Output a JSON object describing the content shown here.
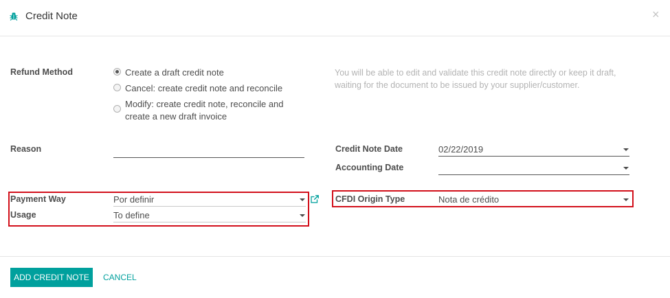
{
  "dialog": {
    "title": "Credit Note",
    "close_label": "×"
  },
  "refund_method": {
    "label": "Refund Method",
    "options": [
      {
        "line1": "Create a draft credit note",
        "line2": "",
        "selected": true
      },
      {
        "line1": "Cancel: create credit note and reconcile",
        "line2": "",
        "selected": false
      },
      {
        "line1": "Modify: create credit note, reconcile and",
        "line2": "create a new draft invoice",
        "selected": false
      }
    ],
    "help_text": "You will be able to edit and validate this credit note directly or keep it draft, waiting for the document to be issued by your supplier/customer."
  },
  "reason": {
    "label": "Reason",
    "value": ""
  },
  "credit_note_date": {
    "label": "Credit Note Date",
    "value": "02/22/2019"
  },
  "accounting_date": {
    "label": "Accounting Date",
    "value": ""
  },
  "payment_way": {
    "label": "Payment Way",
    "value": "Por definir"
  },
  "usage": {
    "label": "Usage",
    "value": "To define"
  },
  "cfdi_origin_type": {
    "label": "CFDI Origin Type",
    "value": "Nota de crédito"
  },
  "footer": {
    "add_button": "ADD CREDIT NOTE",
    "cancel_button": "CANCEL"
  },
  "colors": {
    "accent": "#00a09d",
    "highlight_border": "#d20f1a"
  },
  "icons": {
    "title_icon": "bug-icon",
    "external_link": "external-link-icon"
  }
}
